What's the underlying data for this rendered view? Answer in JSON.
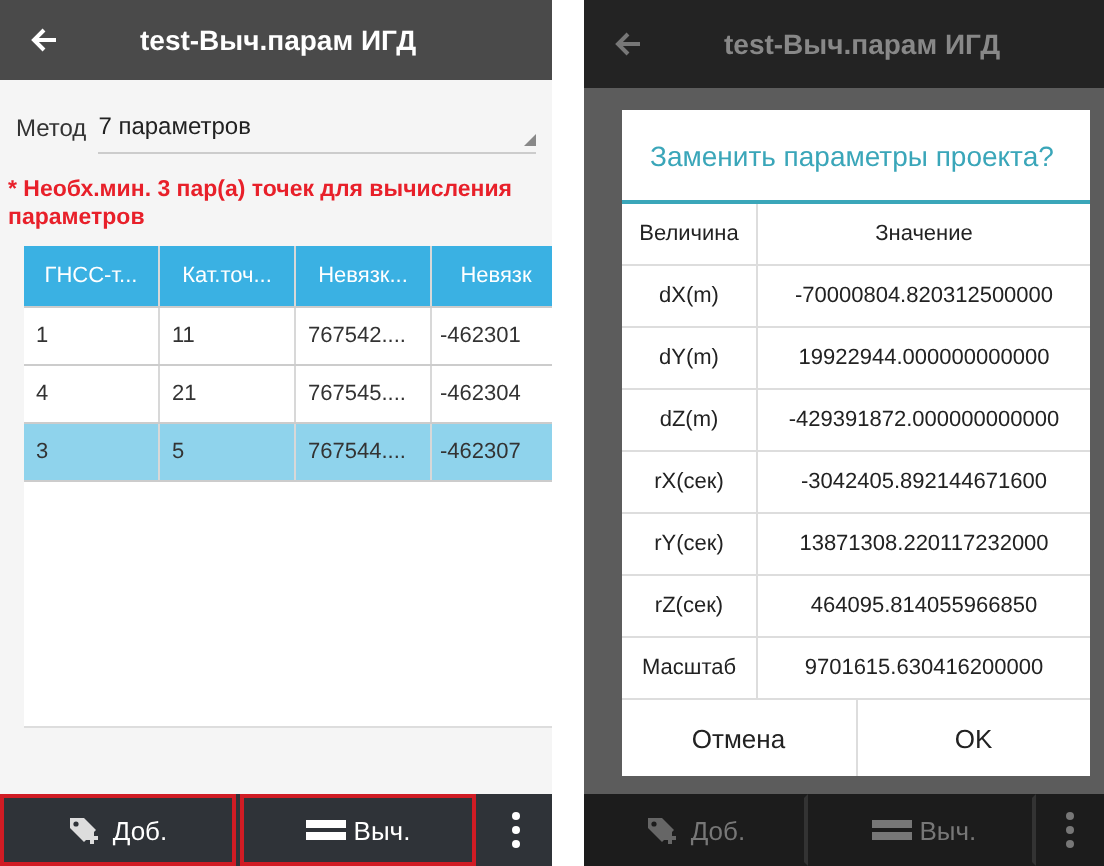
{
  "left_screen": {
    "title_bar": {
      "title": "test-Выч.парам ИГД"
    },
    "method": {
      "label": "Метод",
      "value": "7 параметров"
    },
    "warning": "* Необх.мин. 3 пар(а) точек для вычисления параметров",
    "table": {
      "columns": [
        "ГНСС-т...",
        "Кат.точ...",
        "Невязк...",
        "Невязк"
      ],
      "rows": [
        {
          "cells": [
            "1",
            "11",
            "767542....",
            "-462301"
          ],
          "selected": false
        },
        {
          "cells": [
            "4",
            "21",
            "767545....",
            "-462304"
          ],
          "selected": false
        },
        {
          "cells": [
            "3",
            "5",
            "767544....",
            "-462307"
          ],
          "selected": true
        }
      ]
    },
    "bottom_bar": {
      "buttons": [
        {
          "kind": "tag",
          "label": "Доб.",
          "highlighted": true
        },
        {
          "kind": "list",
          "label": "Выч.",
          "highlighted": true
        }
      ]
    }
  },
  "right_screen": {
    "title_bar": {
      "title": "test-Выч.парам ИГД"
    },
    "dialog": {
      "title": "Заменить параметры проекта?",
      "columns": [
        "Величина",
        "Значение"
      ],
      "rows": [
        {
          "name": "dX(m)",
          "value": "-70000804.820312500000"
        },
        {
          "name": "dY(m)",
          "value": "19922944.000000000000"
        },
        {
          "name": "dZ(m)",
          "value": "-429391872.000000000000"
        },
        {
          "name": "rX(сек)",
          "value": "-3042405.892144671600"
        },
        {
          "name": "rY(сек)",
          "value": "13871308.220117232000"
        },
        {
          "name": "rZ(сек)",
          "value": "464095.814055966850"
        },
        {
          "name": "Масштаб",
          "value": "9701615.630416200000"
        }
      ],
      "buttons": [
        "Отмена",
        "OK"
      ]
    },
    "bottom_bar": {
      "buttons": [
        {
          "kind": "tag",
          "label": "Доб.",
          "highlighted": false
        },
        {
          "kind": "list",
          "label": "Выч.",
          "highlighted": false
        }
      ]
    }
  }
}
